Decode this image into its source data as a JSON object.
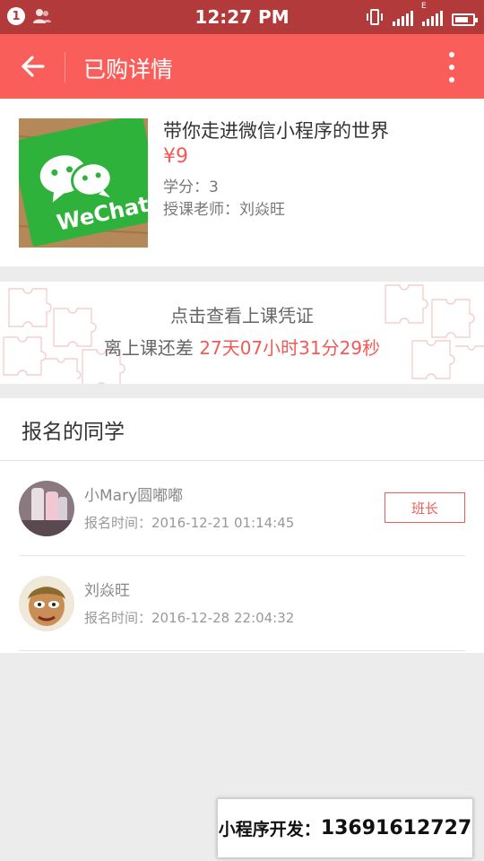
{
  "status_bar": {
    "notification_count": "1",
    "time": "12:27 PM",
    "network_label": "E"
  },
  "app_bar": {
    "title": "已购详情"
  },
  "course": {
    "title": "带你走进微信小程序的世界",
    "price": "¥9",
    "credits": "学分：3",
    "teacher": "授课老师：刘焱旺",
    "thumb_text": "WeChat"
  },
  "ticket": {
    "title": "点击查看上课凭证",
    "countdown_prefix": "离上课还差",
    "countdown_value": "27天07小时31分29秒"
  },
  "classmates": {
    "section_title": "报名的同学",
    "students": [
      {
        "name": "小Mary圆嘟嘟",
        "signup_time": "报名时间：2016-12-21 01:14:45",
        "badge": "班长"
      },
      {
        "name": "刘焱旺",
        "signup_time": "报名时间：2016-12-28 22:04:32"
      }
    ]
  },
  "watermark": {
    "label": "小程序开发：",
    "phone": "13691612727"
  },
  "colors": {
    "status_bar": "#b23a3a",
    "app_bar": "#fa5e5b",
    "accent": "#f05a57",
    "background": "#ececec"
  }
}
